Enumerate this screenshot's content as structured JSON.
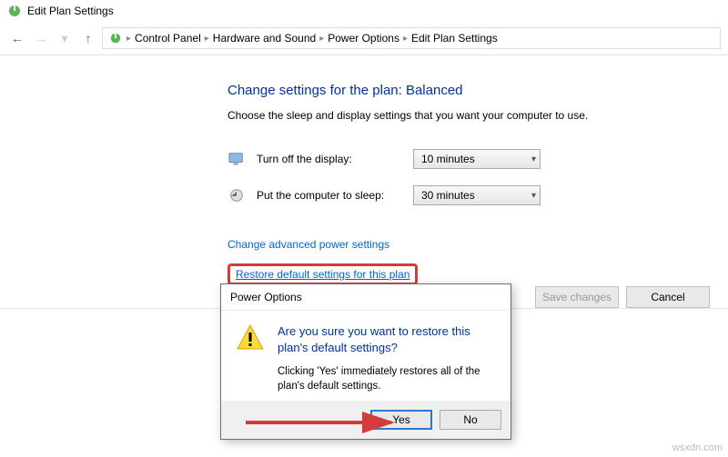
{
  "window": {
    "title": "Edit Plan Settings"
  },
  "nav": {
    "crumbs": [
      "Control Panel",
      "Hardware and Sound",
      "Power Options",
      "Edit Plan Settings"
    ]
  },
  "main": {
    "heading": "Change settings for the plan: Balanced",
    "subtext": "Choose the sleep and display settings that you want your computer to use.",
    "display_label": "Turn off the display:",
    "display_value": "10 minutes",
    "sleep_label": "Put the computer to sleep:",
    "sleep_value": "30 minutes",
    "advanced_link": "Change advanced power settings",
    "restore_link": "Restore default settings for this plan"
  },
  "footer": {
    "save": "Save changes",
    "cancel": "Cancel"
  },
  "dialog": {
    "title": "Power Options",
    "heading": "Are you sure you want to restore this plan's default settings?",
    "text": "Clicking 'Yes' immediately restores all of the plan's default settings.",
    "yes": "Yes",
    "no": "No"
  },
  "watermark": "wsxdn.com"
}
